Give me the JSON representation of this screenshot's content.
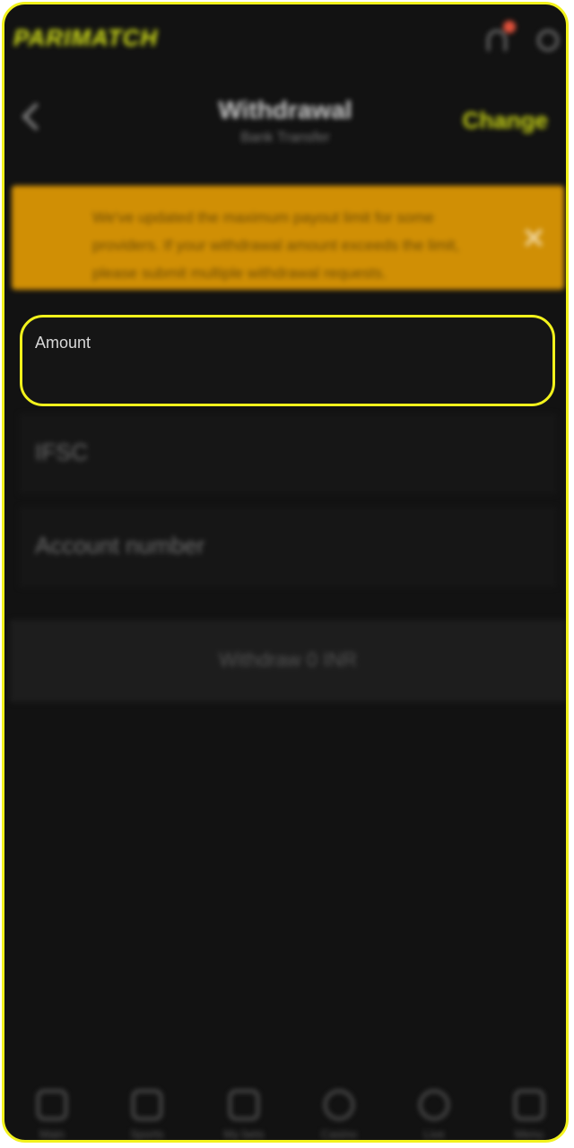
{
  "brand": {
    "logo_text": "PARIMATCH",
    "accent": "#d4e21a"
  },
  "topbar": {
    "notifications_icon": "bell-icon",
    "profile_icon": "user-icon"
  },
  "header": {
    "title": "Withdrawal",
    "subtitle": "Bank Transfer",
    "change_label": "Change"
  },
  "banner": {
    "text": "We've updated the maximum payout limit for some providers. If your withdrawal amount exceeds the limit, please submit multiple withdrawal requests.",
    "color": "#d08f05"
  },
  "form": {
    "amount_label": "Amount",
    "ifsc_placeholder": "IFSC",
    "account_placeholder": "Account number",
    "submit_label": "Withdraw 0 INR"
  },
  "bottom_nav": [
    {
      "label": "Main",
      "icon": "home-icon"
    },
    {
      "label": "Sports",
      "icon": "ticket-icon"
    },
    {
      "label": "My bets",
      "icon": "bets-icon"
    },
    {
      "label": "Casino",
      "icon": "casino-icon"
    },
    {
      "label": "Live",
      "icon": "live-icon"
    },
    {
      "label": "Menu",
      "icon": "menu-icon"
    }
  ]
}
